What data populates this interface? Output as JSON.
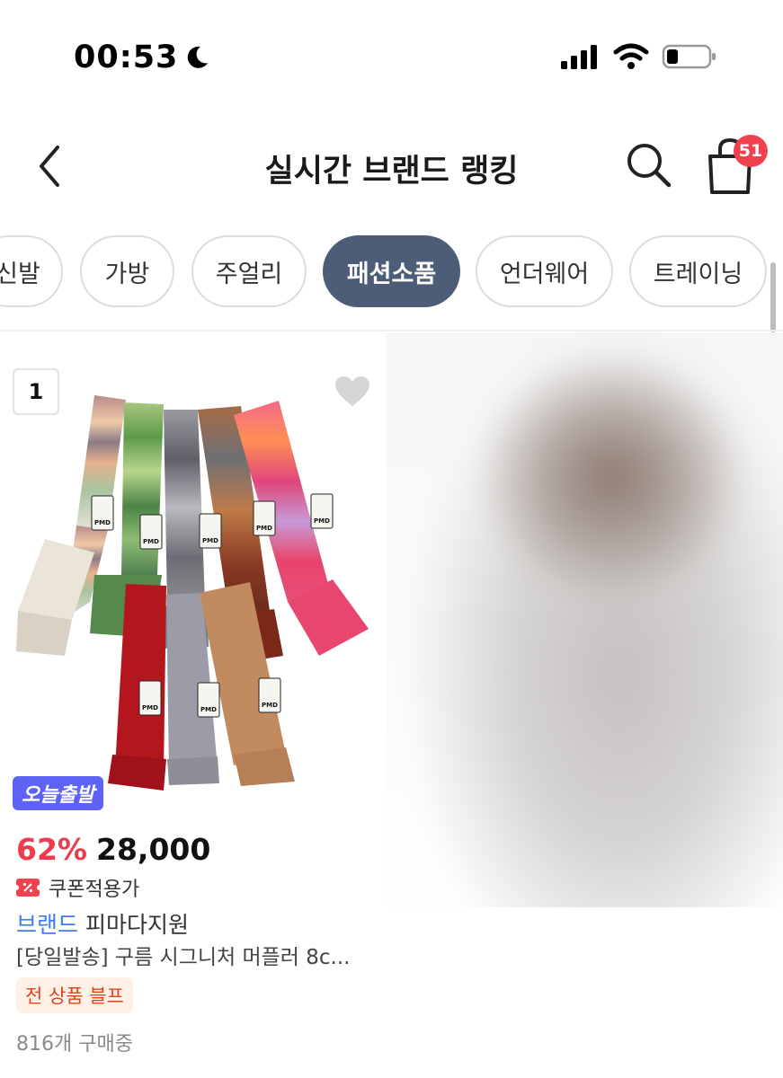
{
  "status_bar": {
    "time": "00:53"
  },
  "header": {
    "title": "실시간 브랜드 랭킹",
    "cart_count": "51"
  },
  "categories": [
    {
      "label": "신발",
      "active": false
    },
    {
      "label": "가방",
      "active": false
    },
    {
      "label": "주얼리",
      "active": false
    },
    {
      "label": "패션소품",
      "active": true
    },
    {
      "label": "언더웨어",
      "active": false
    },
    {
      "label": "트레이닝",
      "active": false
    }
  ],
  "product": {
    "rank": "1",
    "delivery_badge": "오늘출발",
    "discount": "62%",
    "price": "28,000",
    "coupon": "쿠폰적용가",
    "brand_tag": "브랜드",
    "brand_name": "피마다지원",
    "name": "[당일발송] 구름 시그니처 머플러 8c...",
    "promo_badge": "전 상품 블프",
    "purchase_count": "816개 구매중",
    "label_text": "PMD"
  },
  "colors": {
    "accent": "#4d5d78",
    "discount": "#ef3b4e",
    "brand": "#3e7bf4",
    "badge_blue": "#5f63f5",
    "cart_badge": "#f0414f"
  },
  "icons": [
    "moon-icon",
    "signal-icon",
    "wifi-icon",
    "battery-icon",
    "back-arrow-icon",
    "search-icon",
    "shopping-bag-icon",
    "heart-icon",
    "coupon-icon"
  ]
}
